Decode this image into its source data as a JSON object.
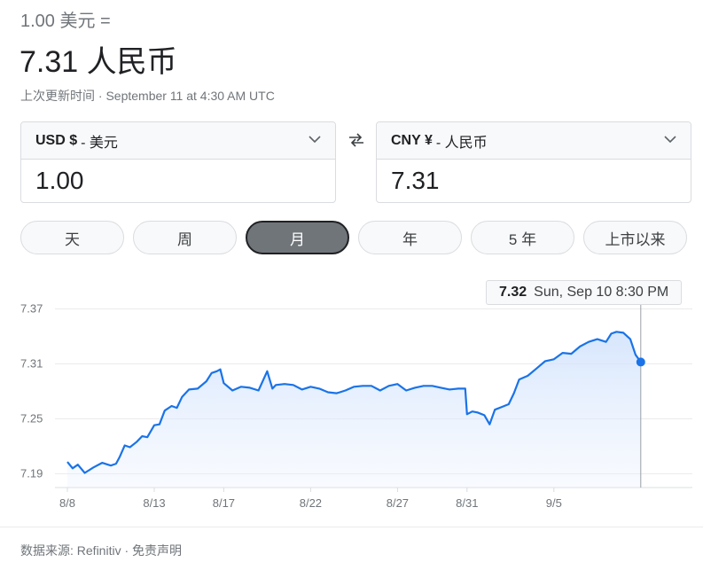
{
  "header": {
    "base_amount_line": "1.00 美元 =",
    "result_line": "7.31 人民币",
    "updated_line": "上次更新时间 · September 11 at 4:30 AM UTC"
  },
  "converter": {
    "from": {
      "code": "USD $",
      "name": "- 美元",
      "amount": "1.00"
    },
    "to": {
      "code": "CNY ¥",
      "name": "- 人民币",
      "amount": "7.31"
    }
  },
  "range_tabs": [
    {
      "label": "天",
      "active": false
    },
    {
      "label": "周",
      "active": false
    },
    {
      "label": "月",
      "active": true
    },
    {
      "label": "年",
      "active": false
    },
    {
      "label": "5 年",
      "active": false
    },
    {
      "label": "上市以来",
      "active": false
    }
  ],
  "tooltip": {
    "value": "7.32",
    "datetime": "Sun, Sep 10 8:30 PM"
  },
  "colors": {
    "line": "#1a73e8",
    "fill": "#e8f0fe",
    "grid": "#ebebeb",
    "active_tab": "#70757a"
  },
  "chart_data": {
    "type": "line",
    "title": "",
    "xlabel": "",
    "ylabel": "",
    "ylim": [
      7.175,
      7.385
    ],
    "yticks": [
      "7.37",
      "7.31",
      "7.25",
      "7.19"
    ],
    "ytick_values": [
      7.37,
      7.31,
      7.25,
      7.19
    ],
    "xticks": [
      "8/8",
      "8/13",
      "8/17",
      "8/22",
      "8/27",
      "8/31",
      "9/5"
    ],
    "xtick_values": [
      0,
      5,
      9,
      14,
      19,
      23,
      28
    ],
    "series": [
      {
        "x": [
          0,
          0.3,
          0.6,
          1.0,
          1.5,
          2.0,
          2.5,
          2.8,
          3.0,
          3.3,
          3.6,
          4.0,
          4.3,
          4.6,
          5.0,
          5.3,
          5.6,
          6.0,
          6.3,
          6.6,
          7.0,
          7.5,
          8.0,
          8.3,
          8.6,
          8.8,
          9.0,
          9.5,
          10.0,
          10.5,
          11.0,
          11.5,
          11.8,
          12.0,
          12.5,
          13.0,
          13.5,
          14.0,
          14.5,
          15.0,
          15.5,
          16.0,
          16.5,
          17.0,
          17.5,
          18.0,
          18.5,
          19.0,
          19.5,
          20.0,
          20.5,
          21.0,
          21.5,
          22.0,
          22.5,
          22.9,
          23.0,
          23.3,
          23.6,
          24.0,
          24.3,
          24.6,
          25.0,
          25.4,
          25.7,
          26.0,
          26.5,
          27.0,
          27.5,
          28.0,
          28.5,
          29.0,
          29.5,
          30.0,
          30.5,
          31.0,
          31.3,
          31.6,
          32.0,
          32.4,
          32.7,
          33.0
        ],
        "y": [
          7.203,
          7.196,
          7.2,
          7.191,
          7.197,
          7.202,
          7.199,
          7.201,
          7.208,
          7.221,
          7.219,
          7.225,
          7.231,
          7.23,
          7.243,
          7.244,
          7.259,
          7.264,
          7.262,
          7.274,
          7.282,
          7.283,
          7.291,
          7.3,
          7.302,
          7.304,
          7.289,
          7.281,
          7.285,
          7.284,
          7.281,
          7.302,
          7.283,
          7.287,
          7.288,
          7.287,
          7.282,
          7.285,
          7.283,
          7.279,
          7.278,
          7.281,
          7.285,
          7.286,
          7.286,
          7.281,
          7.286,
          7.288,
          7.281,
          7.284,
          7.286,
          7.286,
          7.284,
          7.282,
          7.283,
          7.283,
          7.255,
          7.258,
          7.257,
          7.254,
          7.244,
          7.26,
          7.263,
          7.266,
          7.278,
          7.293,
          7.297,
          7.305,
          7.313,
          7.315,
          7.322,
          7.321,
          7.329,
          7.334,
          7.337,
          7.334,
          7.343,
          7.345,
          7.344,
          7.337,
          7.32,
          7.312
        ]
      }
    ],
    "grid": true,
    "legend": "none"
  },
  "footer": {
    "source_label": "数据来源: Refinitiv",
    "separator": " · ",
    "disclaimer_link": "免责声明"
  }
}
